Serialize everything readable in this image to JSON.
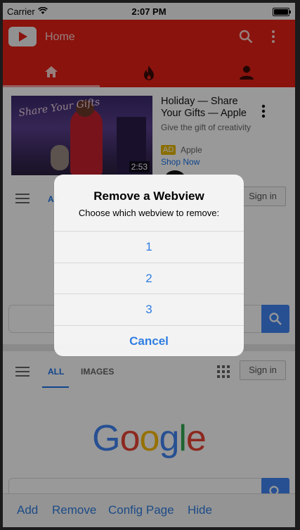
{
  "status_bar": {
    "carrier": "Carrier",
    "time": "2:07 PM",
    "battery_level": 1.0
  },
  "youtube": {
    "header_title": "Home",
    "tabs": [
      "home-icon",
      "trending-icon",
      "account-icon"
    ],
    "active_tab": 0,
    "video": {
      "thumbnail_script": "Share Your Gifts",
      "duration": "2:53",
      "title": "Holiday — Share Your Gifts — Apple",
      "description": "Give the gift of creativity",
      "ad_badge": "AD",
      "advertiser": "Apple",
      "cta": "Shop Now"
    }
  },
  "google_panel_1": {
    "tab_all": "All",
    "sign_in": "Sign in"
  },
  "google_panel_2": {
    "tab_all": "ALL",
    "tab_images": "IMAGES",
    "sign_in": "Sign in",
    "logo": [
      "G",
      "o",
      "o",
      "g",
      "l",
      "e"
    ]
  },
  "toolbar": {
    "add": "Add",
    "remove": "Remove",
    "config": "Config Page",
    "hide": "Hide"
  },
  "alert": {
    "title": "Remove a Webview",
    "message": "Choose which webview to remove:",
    "options": [
      "1",
      "2",
      "3"
    ],
    "cancel": "Cancel"
  },
  "colors": {
    "youtube_red": "#e62117",
    "ios_blue": "#2f7de1",
    "google_blue": "#4285f4"
  }
}
